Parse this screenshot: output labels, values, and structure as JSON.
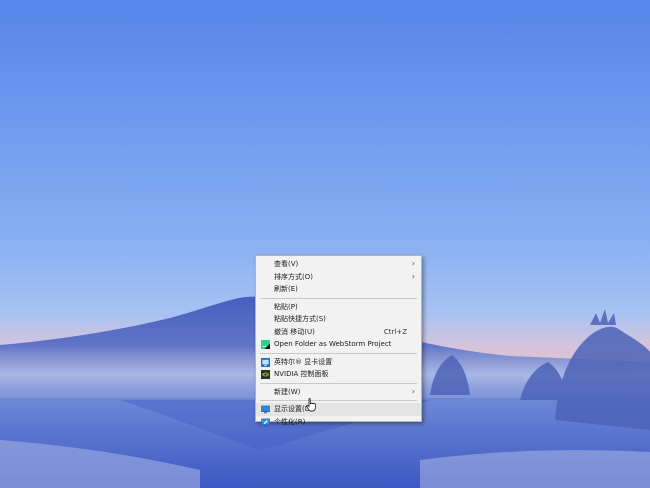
{
  "context_menu": {
    "items": [
      {
        "label": "查看(V)",
        "has_submenu": true
      },
      {
        "label": "排序方式(O)",
        "has_submenu": true
      },
      {
        "label": "刷新(E)"
      },
      {
        "label": "粘贴(P)"
      },
      {
        "label": "粘贴快捷方式(S)"
      },
      {
        "label": "撤消 移动(U)",
        "shortcut": "Ctrl+Z"
      },
      {
        "label": "Open Folder as WebStorm Project",
        "icon": "webstorm-icon"
      },
      {
        "label": "英特尔® 显卡设置",
        "icon": "intel-graphics-icon"
      },
      {
        "label": "NVIDIA 控制面板",
        "icon": "nvidia-icon"
      },
      {
        "label": "新建(W)",
        "has_submenu": true
      },
      {
        "label": "显示设置(D)",
        "icon": "display-settings-icon",
        "highlighted": true
      },
      {
        "label": "个性化(R)",
        "icon": "personalize-icon"
      }
    ],
    "submenu_arrow": "›"
  },
  "colors": {
    "sky_top": "#5684ea",
    "horizon_pink": "#e8b8c4",
    "mountain": "#4a5fbf",
    "menu_background": "#f2f2f2",
    "menu_hover": "#e4e4e4"
  }
}
